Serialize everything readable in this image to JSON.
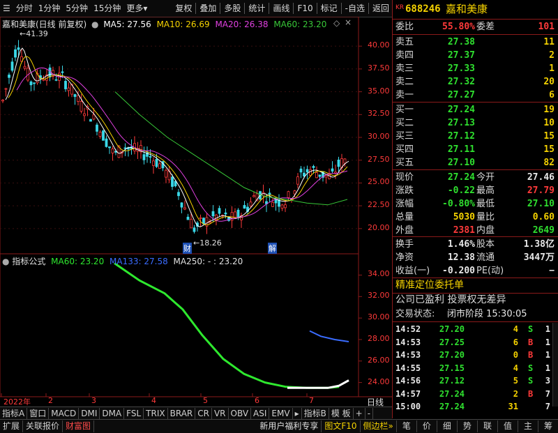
{
  "toolbar": {
    "left": [
      "分时",
      "1分钟",
      "5分钟",
      "15分钟",
      "更多"
    ],
    "right": [
      "复权",
      "叠加",
      "多股",
      "统计",
      "画线",
      "F10",
      "标记",
      "-自选",
      "返回"
    ]
  },
  "chart": {
    "header": {
      "name": "嘉和美康(日线 前复权)",
      "ma5": "MA5: 27.56",
      "ma10": "MA10: 26.69",
      "ma20": "MA20: 26.38",
      "ma60": "MA60: 23.20"
    },
    "price_axis": [
      "40.00",
      "37.50",
      "35.00",
      "32.50",
      "30.00",
      "27.50",
      "25.00",
      "22.50",
      "20.00"
    ],
    "high_label": "41.39",
    "low_label": "18.26",
    "markers": [
      "财",
      "解"
    ],
    "indicator_header": {
      "name": "指标公式",
      "ma60": "MA60: 23.20",
      "ma133": "MA133: 27.58",
      "ma250": "MA250: - : 23.20"
    },
    "ind_axis": [
      "34.00",
      "32.00",
      "30.00",
      "28.00",
      "26.00",
      "24.00"
    ],
    "date_axis": [
      "2022年",
      "2",
      "3",
      "4",
      "5",
      "6",
      "7"
    ],
    "period": "日线"
  },
  "tabbar": [
    "指标A",
    "窗口",
    "MACD",
    "DMI",
    "DMA",
    "FSL",
    "TRIX",
    "BRAR",
    "CR",
    "VR",
    "OBV",
    "ASI",
    "EMV",
    "指标B",
    "模 板",
    "+",
    "-"
  ],
  "statusbar": {
    "left": [
      "扩展",
      "关联报价",
      "财富图"
    ],
    "middle": [
      "新用户福利专享",
      "图文F10",
      "侧边栏"
    ],
    "right": [
      "笔",
      "价",
      "细",
      "势",
      "联",
      "值",
      "主",
      "筹"
    ]
  },
  "quote": {
    "code_prefix": "KR",
    "code": "688246",
    "name": "嘉和美康",
    "webi_label": "委比",
    "webi": "55.80%",
    "weicha_label": "委差",
    "weicha": "101",
    "asks": [
      {
        "label": "卖五",
        "price": "27.38",
        "vol": "11"
      },
      {
        "label": "卖四",
        "price": "27.37",
        "vol": "2"
      },
      {
        "label": "卖三",
        "price": "27.33",
        "vol": "1"
      },
      {
        "label": "卖二",
        "price": "27.32",
        "vol": "20"
      },
      {
        "label": "卖一",
        "price": "27.27",
        "vol": "6"
      }
    ],
    "bids": [
      {
        "label": "买一",
        "price": "27.24",
        "vol": "19"
      },
      {
        "label": "买二",
        "price": "27.13",
        "vol": "10"
      },
      {
        "label": "买三",
        "price": "27.12",
        "vol": "15"
      },
      {
        "label": "买四",
        "price": "27.11",
        "vol": "15"
      },
      {
        "label": "买五",
        "price": "27.10",
        "vol": "82"
      }
    ],
    "stats": [
      {
        "l1": "现价",
        "v1": "27.24",
        "c1": "green",
        "l2": "今开",
        "v2": "27.46",
        "c2": "white"
      },
      {
        "l1": "涨跌",
        "v1": "-0.22",
        "c1": "green",
        "l2": "最高",
        "v2": "27.79",
        "c2": "red"
      },
      {
        "l1": "涨幅",
        "v1": "-0.80%",
        "c1": "green",
        "l2": "最低",
        "v2": "27.10",
        "c2": "green"
      },
      {
        "l1": "总量",
        "v1": "5030",
        "c1": "yellow",
        "l2": "量比",
        "v2": "0.60",
        "c2": "yellow"
      },
      {
        "l1": "外盘",
        "v1": "2381",
        "c1": "red",
        "l2": "内盘",
        "v2": "2649",
        "c2": "green"
      }
    ],
    "stats2": [
      {
        "l1": "换手",
        "v1": "1.46%",
        "l2": "股本",
        "v2": "1.38亿"
      },
      {
        "l1": "净资",
        "v1": "12.38",
        "l2": "流通",
        "v2": "3447万"
      },
      {
        "l1": "收益(一)",
        "v1": "-0.200",
        "l2": "PE(动)",
        "v2": "−"
      }
    ],
    "entrust": "精准定位委托单",
    "note": "公司已盈利 投票权无差异",
    "trade_status_label": "交易状态:",
    "trade_status": "闭市阶段 15:30:05",
    "ticks": [
      {
        "t": "14:52",
        "p": "27.20",
        "v": "4",
        "s": "S",
        "n": "1"
      },
      {
        "t": "14:53",
        "p": "27.25",
        "v": "6",
        "s": "B",
        "n": "1"
      },
      {
        "t": "14:53",
        "p": "27.20",
        "v": "0",
        "s": "B",
        "n": "1"
      },
      {
        "t": "14:55",
        "p": "27.15",
        "v": "4",
        "s": "S",
        "n": "1"
      },
      {
        "t": "14:56",
        "p": "27.12",
        "v": "5",
        "s": "S",
        "n": "3"
      },
      {
        "t": "14:57",
        "p": "27.24",
        "v": "2",
        "s": "B",
        "n": "7"
      },
      {
        "t": "15:00",
        "p": "27.24",
        "v": "31",
        "s": "",
        "n": "7"
      }
    ]
  },
  "colors": {
    "ma5": "#ffffff",
    "ma10": "#f5d200",
    "ma20": "#e040e0",
    "ma60": "#38c838",
    "ind_ma60": "#2ee82e",
    "ind_ma133": "#3a6cff",
    "up": "#ff3a3a",
    "down": "#3ad8e8",
    "border": "#8b1a1a"
  }
}
